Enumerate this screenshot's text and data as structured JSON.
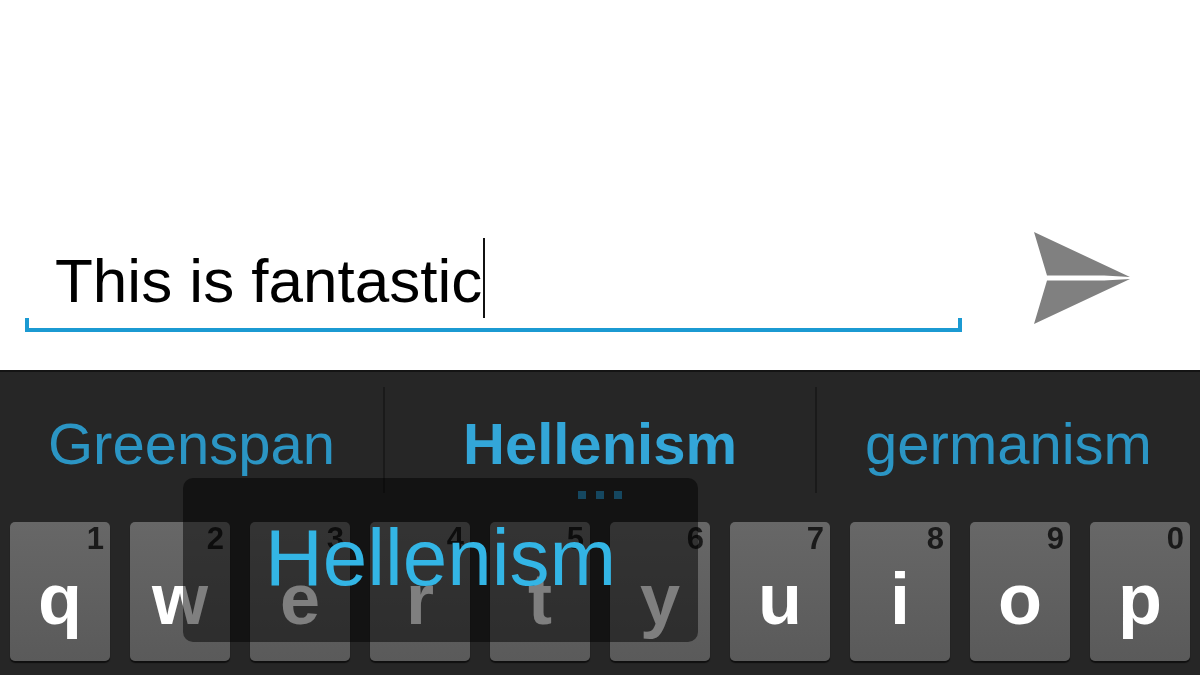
{
  "message_field": {
    "value": "This is fantastic",
    "focused": true
  },
  "suggestions": [
    {
      "text": "Greenspan",
      "selected": false
    },
    {
      "text": "Hellenism",
      "selected": true
    },
    {
      "text": "germanism",
      "selected": false
    }
  ],
  "suggestion_preview": {
    "text": "Hellenism"
  },
  "keys": [
    {
      "letter": "q",
      "number": "1"
    },
    {
      "letter": "w",
      "number": "2"
    },
    {
      "letter": "e",
      "number": "3"
    },
    {
      "letter": "r",
      "number": "4"
    },
    {
      "letter": "t",
      "number": "5"
    },
    {
      "letter": "y",
      "number": "6"
    },
    {
      "letter": "u",
      "number": "7"
    },
    {
      "letter": "i",
      "number": "8"
    },
    {
      "letter": "o",
      "number": "9"
    },
    {
      "letter": "p",
      "number": "0"
    }
  ]
}
